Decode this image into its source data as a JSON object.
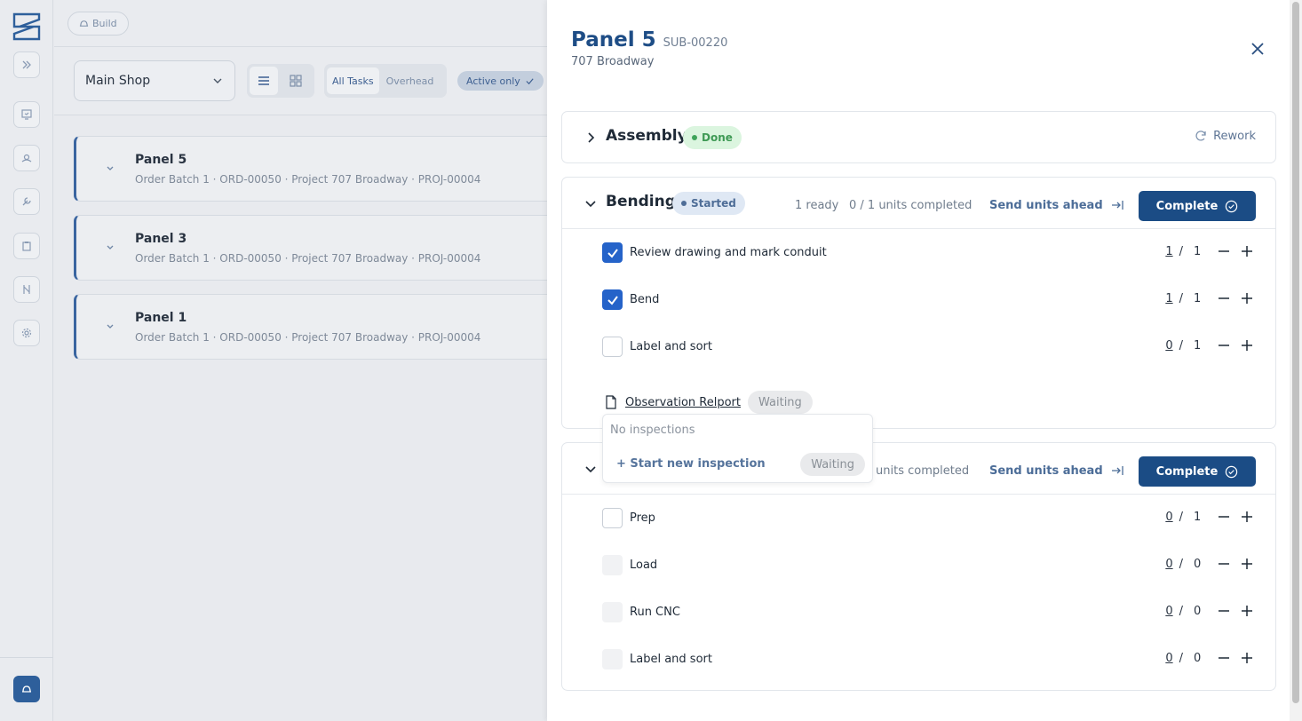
{
  "topbar": {
    "build_label": "Build"
  },
  "toolbar": {
    "shop_select": "Main Shop",
    "tasks_tabs": [
      "All Tasks",
      "Overhead"
    ],
    "active_filter": "Active only"
  },
  "orders": [
    {
      "title": "Panel 5",
      "subtitle": "Order Batch 1 · ORD-00050 · Project 707 Broadway · PROJ-00004"
    },
    {
      "title": "Panel 3",
      "subtitle": "Order Batch 1 · ORD-00050 · Project 707 Broadway · PROJ-00004"
    },
    {
      "title": "Panel 1",
      "subtitle": "Order Batch 1 · ORD-00050 · Project 707 Broadway · PROJ-00004"
    }
  ],
  "drawer": {
    "title": "Panel 5",
    "code": "SUB-00220",
    "address": "707 Broadway",
    "assembly": {
      "title": "Assembly",
      "status": "Done",
      "rework_label": "Rework"
    },
    "bending": {
      "title": "Bending",
      "status": "Started",
      "ready": "1 ready",
      "units": "0 / 1 units completed",
      "send_ahead": "Send units ahead",
      "complete": "Complete",
      "tasks": [
        {
          "label": "Review drawing and mark conduit",
          "done": "1",
          "total": "1",
          "checked": true
        },
        {
          "label": "Bend",
          "done": "1",
          "total": "1",
          "checked": true
        },
        {
          "label": "Label and sort",
          "done": "0",
          "total": "1",
          "checked": false
        }
      ],
      "observation": {
        "label": "Observation Relport",
        "status": "Waiting"
      }
    },
    "next_section": {
      "units": "units completed",
      "send_ahead": "Send units ahead",
      "complete": "Complete",
      "tasks": [
        {
          "label": "Prep",
          "done": "0",
          "total": "1"
        },
        {
          "label": "Load",
          "done": "0",
          "total": "0"
        },
        {
          "label": "Run CNC",
          "done": "0",
          "total": "0"
        },
        {
          "label": "Label and sort",
          "done": "0",
          "total": "0"
        }
      ]
    },
    "popover": {
      "empty": "No inspections",
      "start": "+ Start new inspection",
      "status": "Waiting"
    }
  },
  "colors": {
    "primary": "#1b4c85",
    "accent_check": "#2563c9",
    "done_green": "#3f9a55"
  }
}
